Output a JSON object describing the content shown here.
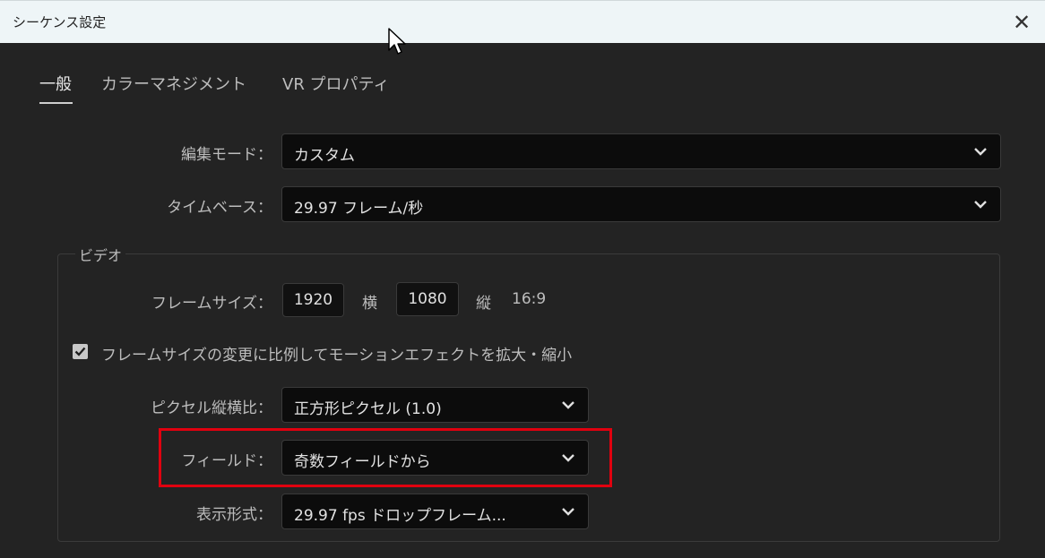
{
  "window": {
    "title": "シーケンス設定",
    "close_glyph": "✕"
  },
  "tabs": [
    {
      "label": "一般",
      "active": true
    },
    {
      "label": "カラーマネジメント",
      "active": false
    },
    {
      "label": "VR プロパティ",
      "active": false
    }
  ],
  "general": {
    "edit_mode_label": "編集モード：",
    "edit_mode_value": "カスタム",
    "timebase_label": "タイムベース：",
    "timebase_value": "29.97  フレーム/秒"
  },
  "video": {
    "group_title": "ビデオ",
    "frame_size_label": "フレームサイズ：",
    "width": "1920",
    "width_unit": "横",
    "height": "1080",
    "height_unit": "縦",
    "aspect": "16:9",
    "scale_checkbox_label": "フレームサイズの変更に比例してモーションエフェクトを拡大・縮小",
    "scale_checked": true,
    "pixel_aspect_label": "ピクセル縦横比：",
    "pixel_aspect_value": "正方形ピクセル (1.0)",
    "fields_label": "フィールド：",
    "fields_value": "奇数フィールドから",
    "display_format_label": "表示形式：",
    "display_format_value": "29.97 fps ドロップフレーム..."
  },
  "colors": {
    "highlight": "#e0000f",
    "background": "#232323",
    "titlebar": "#eef5f7"
  }
}
